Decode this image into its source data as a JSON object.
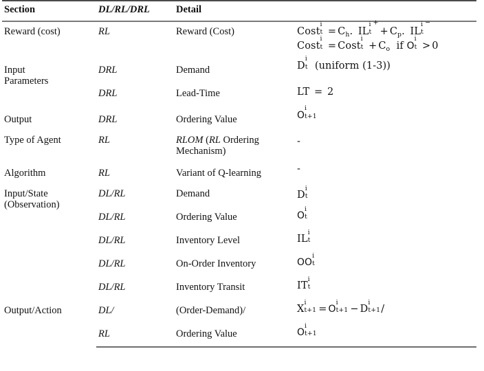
{
  "table": {
    "headers": {
      "section": "Section",
      "type": "DL/RL/DRL",
      "detail": "Detail",
      "formula": ""
    },
    "rows": [
      {
        "section": "Reward (cost)",
        "type": "RL",
        "detail": "Reward (Cost)",
        "formula_lines": [
          "Costᵢᵗ = Cₕ. ILᵗⁱ⁺ + Cₚ. ILᵗⁱ⁻",
          "Costᵢᵗ = Costᵢᵗ + Cₒ  if Oᵗⁱ > 0"
        ],
        "formula_plain_1": "Cost^i_t = C_h. IL_t^{i+} + C_p. IL_t^{i-}",
        "formula_plain_2": "Cost^i_t = Cost^i_t + C_o  if O^i_t > 0"
      },
      {
        "section": "Input Parameters",
        "type": "DRL",
        "detail": "Demand",
        "formula_plain_1": "D^i_t (uniform (1-3))"
      },
      {
        "section": "",
        "type": "DRL",
        "detail": "Lead-Time",
        "formula_plain_1": "LT = 2"
      },
      {
        "section": "Output",
        "type": "DRL",
        "detail": "Ordering Value",
        "formula_plain_1": "O^i_{t+1}"
      },
      {
        "section": "Type of Agent",
        "type": "RL",
        "detail": "RLOM (RL Ordering Mechanism)",
        "detail_italic_parts": [
          "RLOM",
          "RL"
        ],
        "formula_plain_1": "-"
      },
      {
        "section": "Algorithm",
        "type": "RL",
        "detail": "Variant of Q-learning",
        "formula_plain_1": "-"
      },
      {
        "section": "Input/State (Observation)",
        "type": "DL/RL",
        "detail": "Demand",
        "formula_plain_1": "D^i_t"
      },
      {
        "section": "",
        "type": "DL/RL",
        "detail": "Ordering Value",
        "formula_plain_1": "O^i_t"
      },
      {
        "section": "",
        "type": "DL/RL",
        "detail": "Inventory Level",
        "formula_plain_1": "IL^i_t"
      },
      {
        "section": "",
        "type": "DL/RL",
        "detail": "On-Order Inventory",
        "formula_plain_1": "OO^i_t"
      },
      {
        "section": "",
        "type": "DL/RL",
        "detail": "Inventory Transit",
        "formula_plain_1": "IT^i_t"
      },
      {
        "section": "Output/Action",
        "type": "DL/",
        "detail": "(Order-Demand)/",
        "formula_plain_1": "X^i_{t+1} = O^i_{t+1} - D^i_{t+1}/"
      },
      {
        "section": "",
        "type": "RL",
        "detail": "Ordering Value",
        "formula_plain_1": "O^i_{t+1}"
      }
    ],
    "row_labels": {
      "section_multiline_1": [
        "Input",
        "Parameters"
      ],
      "section_multiline_2": [
        "Input/State",
        "(Observation)"
      ],
      "detail_multiline_type_of_agent": [
        "RLOM (RL Ordering",
        "Mechanism)"
      ]
    },
    "symbols": {
      "dash": "-",
      "equals": "=",
      "plus": "+",
      "minus": "−",
      "greater_than": ">",
      "slash": "/"
    },
    "colors": {
      "text": "#111111",
      "rule_top": "#4a4a4a",
      "rule_header": "#7a7a7a",
      "rule_bottom": "#6e6e6e",
      "background": "#ffffff"
    }
  }
}
